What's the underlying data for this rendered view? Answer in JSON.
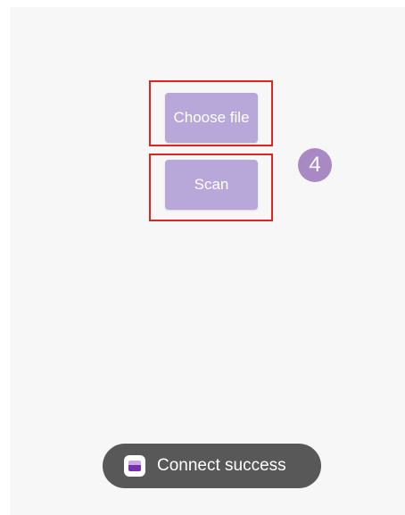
{
  "colors": {
    "button_bg": "#b7a8d9",
    "highlight_border": "#e0241e",
    "step_badge_bg": "#a889c4",
    "toast_bg": "#585858"
  },
  "buttons": {
    "choose_file_label": "Choose file",
    "scan_label": "Scan"
  },
  "step_badge": {
    "number": "4"
  },
  "toast": {
    "icon": "app-icon",
    "message": "Connect success"
  }
}
